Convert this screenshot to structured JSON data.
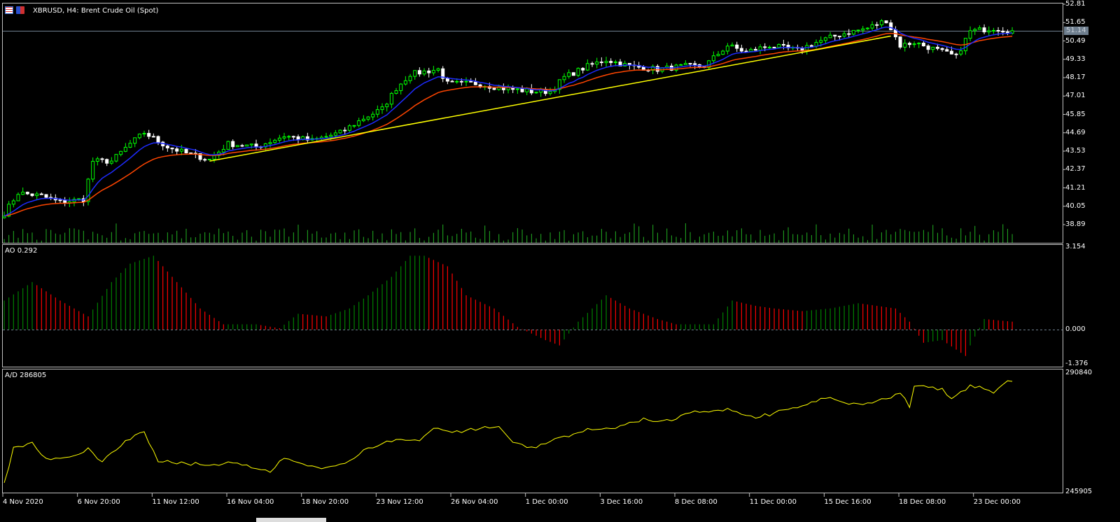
{
  "window": {
    "title": "XBRUSD, H4:  Brent Crude Oil (Spot)",
    "icons": [
      "chart-window-icon",
      "save-icon"
    ]
  },
  "colors": {
    "bull": "#00ff00",
    "bear": "#ffffff",
    "ma_fast": "#1e2bff",
    "ma_slow": "#ff4500",
    "trend": "#ffff00",
    "ao_up": "#008000",
    "ao_down": "#ff0000",
    "ad": "#ffff00",
    "grid": "#c0c0c0"
  },
  "price_axis": [
    "52.81",
    "51.65",
    "50.49",
    "49.33",
    "48.17",
    "47.01",
    "45.85",
    "44.69",
    "43.53",
    "42.37",
    "41.21",
    "40.05",
    "38.89"
  ],
  "current_price": "51.14",
  "ao": {
    "label": "AO 0.292",
    "axis": [
      "3.154",
      "0.000",
      "-1.376"
    ]
  },
  "ad": {
    "label": "A/D 286805",
    "axis": [
      "290840",
      "245905"
    ]
  },
  "time_axis": [
    "4 Nov 2020",
    "6 Nov 20:00",
    "11 Nov 12:00",
    "16 Nov 04:00",
    "18 Nov 20:00",
    "23 Nov 12:00",
    "26 Nov 04:00",
    "1 Dec 00:00",
    "3 Dec 16:00",
    "8 Dec 08:00",
    "11 Dec 00:00",
    "15 Dec 16:00",
    "18 Dec 08:00",
    "23 Dec 00:00"
  ],
  "chart_data": {
    "type": "line",
    "bars": 217,
    "price_range": [
      37.7,
      52.81
    ],
    "close_keypoints": [
      [
        0,
        39.6
      ],
      [
        3,
        40.9
      ],
      [
        8,
        40.7
      ],
      [
        12,
        40.3
      ],
      [
        17,
        40.5
      ],
      [
        19,
        42.9
      ],
      [
        23,
        42.9
      ],
      [
        27,
        44.0
      ],
      [
        30,
        44.7
      ],
      [
        35,
        43.8
      ],
      [
        39,
        43.4
      ],
      [
        44,
        43.0
      ],
      [
        48,
        44.0
      ],
      [
        54,
        43.8
      ],
      [
        60,
        44.5
      ],
      [
        66,
        44.2
      ],
      [
        72,
        44.7
      ],
      [
        77,
        45.6
      ],
      [
        81,
        46.2
      ],
      [
        84,
        47.5
      ],
      [
        87,
        48.4
      ],
      [
        93,
        48.7
      ],
      [
        95,
        47.8
      ],
      [
        101,
        47.8
      ],
      [
        107,
        47.5
      ],
      [
        113,
        47.3
      ],
      [
        117,
        47.3
      ],
      [
        120,
        48.2
      ],
      [
        125,
        48.9
      ],
      [
        129,
        49.3
      ],
      [
        134,
        48.9
      ],
      [
        140,
        48.7
      ],
      [
        146,
        48.9
      ],
      [
        150,
        48.9
      ],
      [
        155,
        50.2
      ],
      [
        159,
        49.8
      ],
      [
        164,
        50.2
      ],
      [
        170,
        49.9
      ],
      [
        174,
        50.4
      ],
      [
        179,
        50.9
      ],
      [
        185,
        51.3
      ],
      [
        189,
        51.8
      ],
      [
        192,
        50.2
      ],
      [
        195,
        50.4
      ],
      [
        200,
        49.9
      ],
      [
        204,
        49.5
      ],
      [
        207,
        51.1
      ],
      [
        212,
        51.3
      ],
      [
        216,
        51.1
      ]
    ],
    "trendline": [
      [
        44,
        42.9
      ],
      [
        190,
        50.8
      ]
    ],
    "ao_range": [
      -1.376,
      3.154
    ],
    "ao_keypoints": [
      [
        0,
        1.1
      ],
      [
        6,
        1.8
      ],
      [
        12,
        1.1
      ],
      [
        18,
        0.5
      ],
      [
        23,
        1.8
      ],
      [
        27,
        2.5
      ],
      [
        32,
        2.8
      ],
      [
        36,
        2.0
      ],
      [
        42,
        0.8
      ],
      [
        47,
        0.2
      ],
      [
        54,
        0.2
      ],
      [
        59,
        0.05
      ],
      [
        63,
        0.6
      ],
      [
        69,
        0.5
      ],
      [
        74,
        0.8
      ],
      [
        78,
        1.3
      ],
      [
        83,
        2.0
      ],
      [
        87,
        2.8
      ],
      [
        90,
        2.8
      ],
      [
        95,
        2.4
      ],
      [
        99,
        1.3
      ],
      [
        105,
        0.8
      ],
      [
        110,
        0.1
      ],
      [
        116,
        -0.4
      ],
      [
        119,
        -0.6
      ],
      [
        123,
        0.3
      ],
      [
        129,
        1.3
      ],
      [
        134,
        0.8
      ],
      [
        140,
        0.4
      ],
      [
        144,
        0.2
      ],
      [
        152,
        0.2
      ],
      [
        156,
        1.1
      ],
      [
        161,
        0.9
      ],
      [
        165,
        0.8
      ],
      [
        171,
        0.7
      ],
      [
        177,
        0.8
      ],
      [
        183,
        1.0
      ],
      [
        191,
        0.8
      ],
      [
        194,
        0.3
      ],
      [
        197,
        -0.5
      ],
      [
        201,
        -0.4
      ],
      [
        206,
        -1.0
      ],
      [
        207,
        -0.6
      ],
      [
        210,
        0.4
      ],
      [
        216,
        0.3
      ]
    ],
    "ad_range": [
      245905,
      290840
    ],
    "ad_keypoints": [
      [
        0,
        249345
      ],
      [
        2,
        262560
      ],
      [
        6,
        264670
      ],
      [
        9,
        258600
      ],
      [
        14,
        258600
      ],
      [
        18,
        262560
      ],
      [
        21,
        257270
      ],
      [
        26,
        264670
      ],
      [
        30,
        268640
      ],
      [
        33,
        257270
      ],
      [
        38,
        256740
      ],
      [
        44,
        255950
      ],
      [
        48,
        257270
      ],
      [
        53,
        255150
      ],
      [
        57,
        253310
      ],
      [
        60,
        258600
      ],
      [
        65,
        255950
      ],
      [
        69,
        255150
      ],
      [
        74,
        257270
      ],
      [
        78,
        262560
      ],
      [
        84,
        265730
      ],
      [
        89,
        265200
      ],
      [
        92,
        270490
      ],
      [
        96,
        268380
      ],
      [
        101,
        269700
      ],
      [
        106,
        270490
      ],
      [
        109,
        264670
      ],
      [
        114,
        262560
      ],
      [
        119,
        266520
      ],
      [
        125,
        269170
      ],
      [
        131,
        270490
      ],
      [
        137,
        273130
      ],
      [
        143,
        272600
      ],
      [
        147,
        275770
      ],
      [
        155,
        277100
      ],
      [
        161,
        273660
      ],
      [
        165,
        275770
      ],
      [
        171,
        278420
      ],
      [
        177,
        281590
      ],
      [
        179,
        279740
      ],
      [
        185,
        278950
      ],
      [
        189,
        281060
      ],
      [
        192,
        283180
      ],
      [
        194,
        278420
      ],
      [
        195,
        285820
      ],
      [
        201,
        285030
      ],
      [
        203,
        281060
      ],
      [
        207,
        286350
      ],
      [
        212,
        283710
      ],
      [
        215,
        287670
      ],
      [
        216,
        287670
      ]
    ]
  }
}
